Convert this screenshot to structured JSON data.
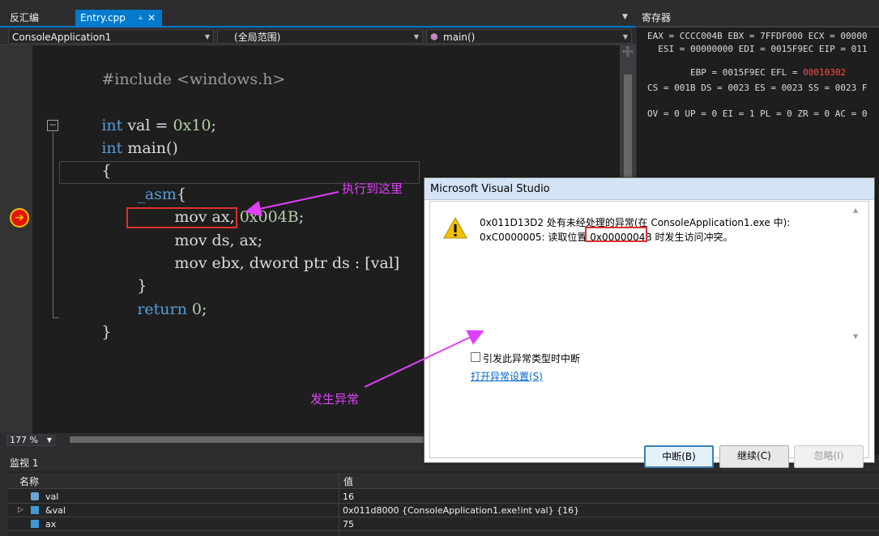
{
  "tabs": {
    "disasm": "反汇编",
    "active": "Entry.cpp",
    "pin_icon": "pin-icon",
    "close_icon": "close-icon"
  },
  "nav": {
    "project": "ConsoleApplication1",
    "scope": "(全局范围)",
    "function": "main()"
  },
  "code": {
    "line1_pp": "#include ",
    "line1_hdr": "<windows.h>",
    "line3_kw": "int",
    "line3_rest": " val = ",
    "line3_num": "0x10",
    "line3_end": ";",
    "line4_kw": "int",
    "line4_rest": " main()",
    "line5": "{",
    "line6_kw": "_asm",
    "line6_rest": "{",
    "line7_a": "mov ax, ",
    "line7_num": "0x004B",
    "line7_end": ";",
    "line8": "mov ds, ax;",
    "line9": "mov ebx, dword ptr ds : [val]",
    "line10": "}",
    "line11_kw": "return",
    "line11_num": " 0",
    "line11_end": ";",
    "line12": "}"
  },
  "annotations": {
    "executed_to_here": "执行到这里",
    "exception_occurred": "发生异常"
  },
  "zoom": "177 %",
  "registers": {
    "title": "寄存器",
    "line1": "EAX = CCCC004B EBX = 7FFDF000 ECX = 00000",
    "line2": "  ESI = 00000000 EDI = 0015F9EC EIP = 011",
    "line3a": "  EBP = 0015F9EC EFL = ",
    "line3b": "00010302",
    "line4": "CS = 001B DS = 0023 ES = 0023 SS = 0023 F",
    "line5": "OV = 0 UP = 0 EI = 1 PL = 0 ZR = 0 AC = 0"
  },
  "watch": {
    "title": "监视 1",
    "col_name": "名称",
    "col_value": "值",
    "rows": [
      {
        "name": "val",
        "value": "16"
      },
      {
        "name": "&val",
        "value": "0x011d8000 {ConsoleApplication1.exe!int val} {16}"
      },
      {
        "name": "ax",
        "value": "75"
      }
    ]
  },
  "dialog": {
    "title": "Microsoft Visual Studio",
    "message_line1": "0x011D13D2 处有未经处理的异常(在 ConsoleApplication1.exe 中):",
    "message_line2_a": "0xC0000005:  读取位置 ",
    "message_line2_addr": "0x0000004B",
    "message_line2_b": " 时发生访问冲突。",
    "checkbox_label": "引发此异常类型时中断",
    "link": "打开异常设置(S)",
    "btn_break": "中断(B)",
    "btn_continue": "继续(C)",
    "btn_ignore": "忽略(I)"
  },
  "colors": {
    "accent": "#007acc",
    "annotation": "#e040fb",
    "highlight": "#e03030",
    "register_changed": "#ff4c4c"
  }
}
